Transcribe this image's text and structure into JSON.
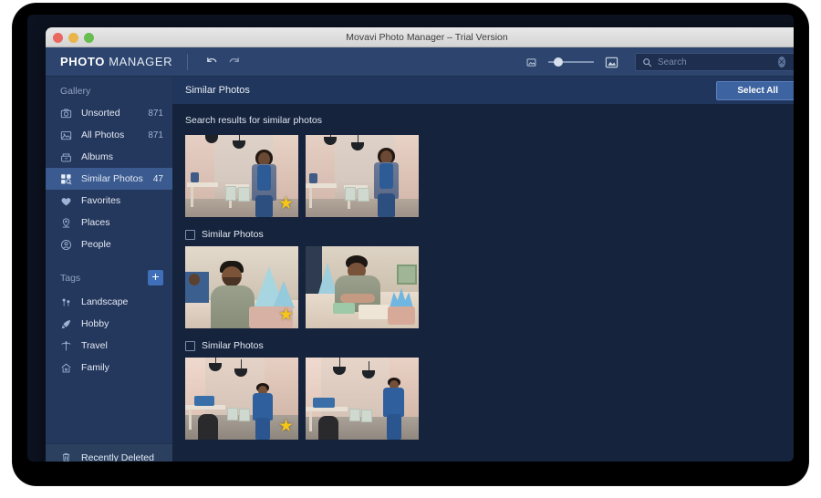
{
  "window": {
    "title": "Movavi Photo Manager – Trial Version",
    "traffic_lights": [
      "close",
      "minimize",
      "maximize"
    ]
  },
  "toolbar": {
    "brand_bold": "PHOTO",
    "brand_light": " MANAGER",
    "undo_icon": "undo-icon",
    "redo_icon": "redo-icon",
    "zoom_small_icon": "small-thumbnail-icon",
    "zoom_large_icon": "large-thumbnail-icon",
    "zoom_value": 12,
    "search": {
      "placeholder": "Search",
      "value": "",
      "search_icon": "search-icon",
      "clear_icon": "clear-icon",
      "calendar_icon": "calendar-icon"
    }
  },
  "sidebar": {
    "gallery_header": "Gallery",
    "items": [
      {
        "label": "Unsorted",
        "count": "871",
        "icon": "camera-icon",
        "active": false
      },
      {
        "label": "All Photos",
        "count": "871",
        "icon": "photo-icon",
        "active": false
      },
      {
        "label": "Albums",
        "count": "",
        "icon": "album-icon",
        "active": false
      },
      {
        "label": "Similar Photos",
        "count": "47",
        "icon": "similar-photos-icon",
        "active": true
      },
      {
        "label": "Favorites",
        "count": "",
        "icon": "heart-icon",
        "active": false
      },
      {
        "label": "Places",
        "count": "",
        "icon": "location-pin-icon",
        "active": false
      },
      {
        "label": "People",
        "count": "",
        "icon": "person-icon",
        "active": false
      }
    ],
    "tags_header": "Tags",
    "add_tag_label": "+",
    "tags": [
      {
        "label": "Landscape",
        "icon": "landscape-icon"
      },
      {
        "label": "Hobby",
        "icon": "hobby-icon"
      },
      {
        "label": "Travel",
        "icon": "palm-tree-icon"
      },
      {
        "label": "Family",
        "icon": "home-icon"
      }
    ],
    "recently_deleted": {
      "label": "Recently Deleted",
      "icon": "trash-icon"
    }
  },
  "content": {
    "title": "Similar Photos",
    "select_all_label": "Select All",
    "results_label": "Search results for similar photos",
    "groups": [
      {
        "label": "",
        "checked": false,
        "show_checkbox": false,
        "photos": [
          {
            "scene": "shop",
            "starred": true
          },
          {
            "scene": "shop",
            "starred": false
          }
        ]
      },
      {
        "label": "Similar Photos",
        "checked": false,
        "show_checkbox": true,
        "photos": [
          {
            "scene": "craft",
            "starred": true
          },
          {
            "scene": "craft2",
            "starred": false
          }
        ]
      },
      {
        "label": "Similar Photos",
        "checked": false,
        "show_checkbox": true,
        "photos": [
          {
            "scene": "corridor",
            "starred": true
          },
          {
            "scene": "corridor2",
            "starred": false
          }
        ]
      }
    ]
  },
  "colors": {
    "sidebar_bg": "#24375c",
    "content_bg": "#16233c",
    "header_bg": "#21365c",
    "toolbar_bg": "#2d456e",
    "accent": "#3d63a0",
    "active_item": "#3a5a90",
    "star": "#f5c518"
  },
  "scrollbar": {
    "thumb_top_pct": 76,
    "thumb_height_pct": 22
  }
}
